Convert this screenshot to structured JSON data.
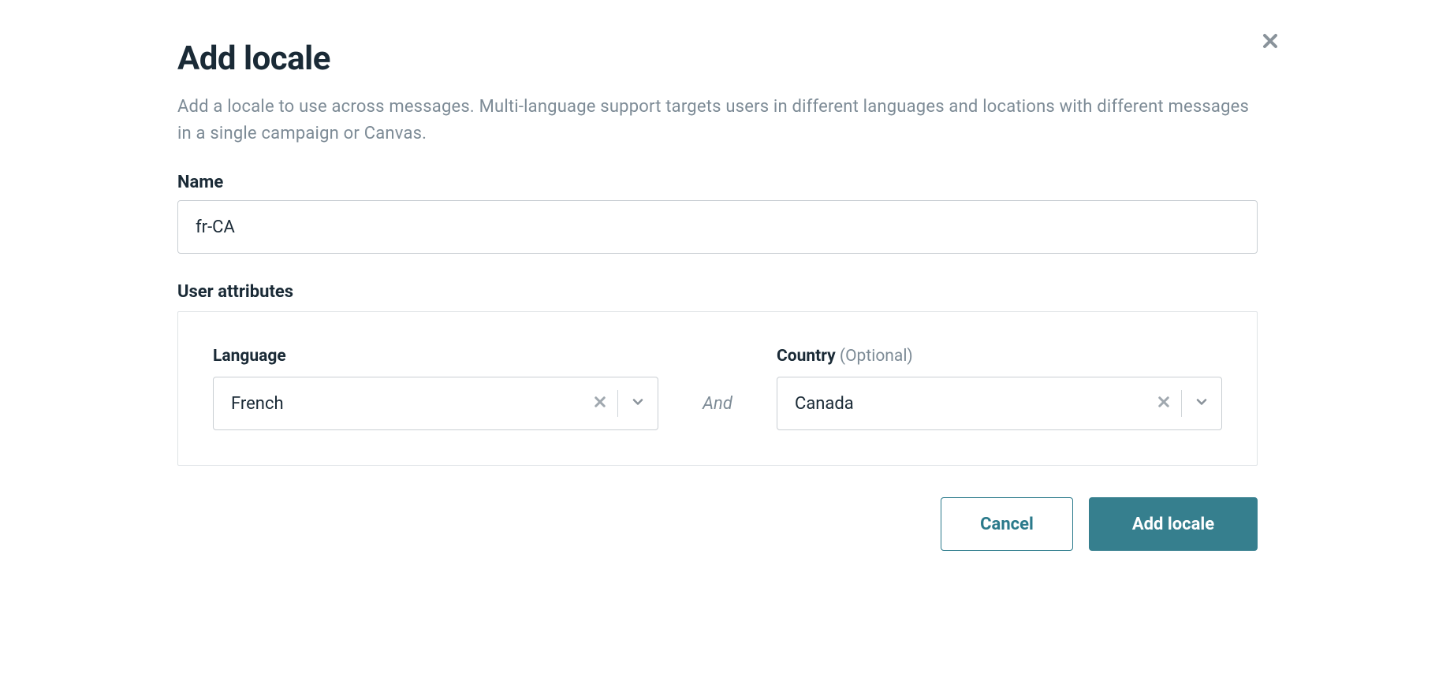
{
  "dialog": {
    "title": "Add locale",
    "description": "Add a locale to use across messages. Multi-language support targets users in different languages and locations with different messages in a single campaign or Canvas."
  },
  "name_field": {
    "label": "Name",
    "value": "fr-CA"
  },
  "user_attributes": {
    "heading": "User attributes",
    "language": {
      "label": "Language",
      "value": "French"
    },
    "conjunction": "And",
    "country": {
      "label": "Country",
      "optional_suffix": "(Optional)",
      "value": "Canada"
    }
  },
  "footer": {
    "cancel": "Cancel",
    "submit": "Add locale"
  }
}
